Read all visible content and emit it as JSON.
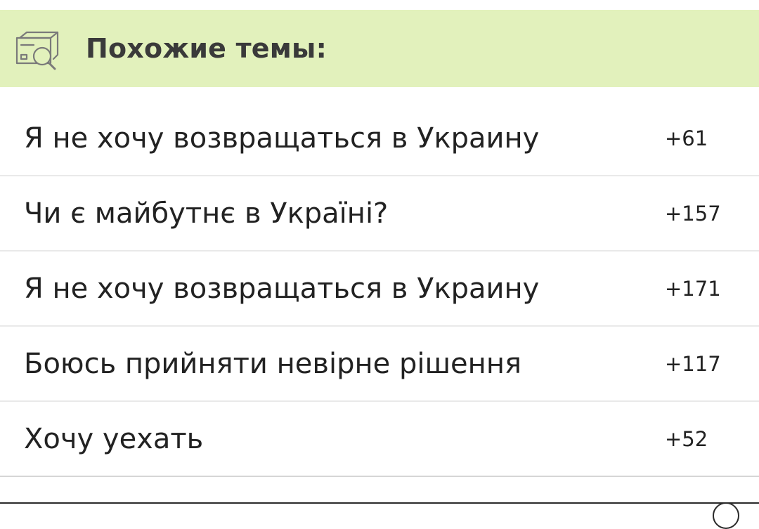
{
  "header": {
    "title": "Похожие темы:",
    "icon": "related-topics-icon",
    "background_color": "#e2f1bc"
  },
  "topics": [
    {
      "title": "Я не хочу возвращаться в Украину",
      "count": "+61"
    },
    {
      "title": "Чи є майбутнє в Україні?",
      "count": "+157"
    },
    {
      "title": "Я не хочу возвращаться в Украину",
      "count": "+171"
    },
    {
      "title": "Боюсь прийняти невірне рішення",
      "count": "+117"
    },
    {
      "title": "Хочу уехать",
      "count": "+52"
    }
  ]
}
